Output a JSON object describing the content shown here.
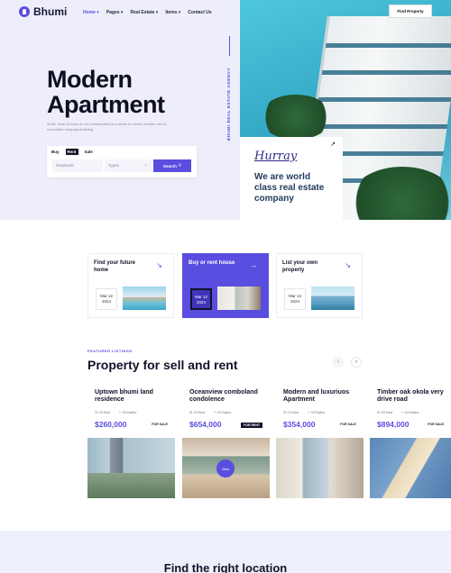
{
  "brand": {
    "name": "Bhumi"
  },
  "nav": {
    "items": [
      "Home",
      "Pages",
      "Real Estate",
      "Items",
      "Contact Us"
    ],
    "find_label": "Find Property"
  },
  "hero": {
    "title_line1": "Modern",
    "title_line2": "Apartment",
    "subtitle": "At the heart of each of our communities is a desire to create a better mix of real estate company building.",
    "vertical_label": "BHUMI REAL ESTATE AGENCY"
  },
  "search": {
    "tabs": [
      "Buy",
      "Rent",
      "Sale"
    ],
    "keyword_placeholder": "Keywords",
    "type_placeholder": "Types",
    "search_label": "Search"
  },
  "promo": {
    "script_word": "Hurray",
    "text": "We are world class real estate company"
  },
  "services": [
    {
      "title": "Find your future home",
      "date_line1": "Mar 12",
      "date_line2": "2024"
    },
    {
      "title": "Buy or rent house",
      "date_line1": "Mar 12",
      "date_line2": "2024"
    },
    {
      "title": "List your own property",
      "date_line1": "Mar 12",
      "date_line2": "2024"
    }
  ],
  "featured": {
    "label": "FEATURED LISTINGS",
    "title": "Property for sell and rent",
    "properties": [
      {
        "title": "Uptown bhumi land residence",
        "beds": "03 Bed",
        "baths": "03 Baths",
        "price": "$260,000",
        "tag": "FOR SALE",
        "view": ""
      },
      {
        "title": "Oceanview comboland condolence",
        "beds": "03 Bed",
        "baths": "03 Baths",
        "price": "$654,000",
        "tag": "FOR RENT",
        "view": "View"
      },
      {
        "title": "Modern and luxuriuos Apartment",
        "beds": "03 Bed",
        "baths": "03 Baths",
        "price": "$354,000",
        "tag": "FOR SALE",
        "view": ""
      },
      {
        "title": "Timber oak okola very drive road",
        "beds": "03 Bed",
        "baths": "03 Baths",
        "price": "$894,000",
        "tag": "FOR SALE",
        "view": ""
      }
    ]
  },
  "bottom": {
    "title": "Find the right location"
  }
}
